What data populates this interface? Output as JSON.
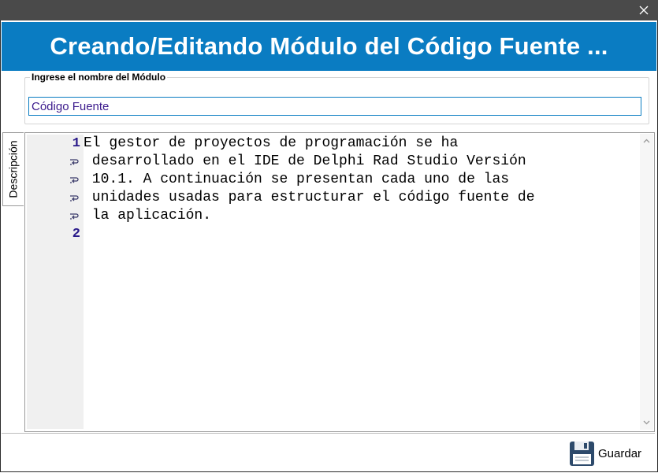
{
  "window": {
    "close_glyph": "✕"
  },
  "header": {
    "title": "Creando/Editando Módulo del Código Fuente ..."
  },
  "module": {
    "legend": "Ingrese el nombre del Módulo",
    "value": "Código Fuente"
  },
  "tab": {
    "label": "Descripción"
  },
  "editor": {
    "line_numbers": [
      "1",
      "2"
    ],
    "lines": [
      "El gestor de proyectos de programación se ha",
      " desarrollado en el IDE de Delphi Rad Studio Versión",
      " 10.1. A continuación se presentan cada uno de las",
      " unidades usadas para estructurar el código fuente de",
      " la aplicación."
    ]
  },
  "footer": {
    "save_label": "Guardar",
    "save_icon": "floppy-disk-icon"
  },
  "colors": {
    "accent": "#0a7cc2",
    "titlebar": "#4a4a4a",
    "line_number": "#2a1a8a",
    "input_text": "#3b1a8c"
  }
}
